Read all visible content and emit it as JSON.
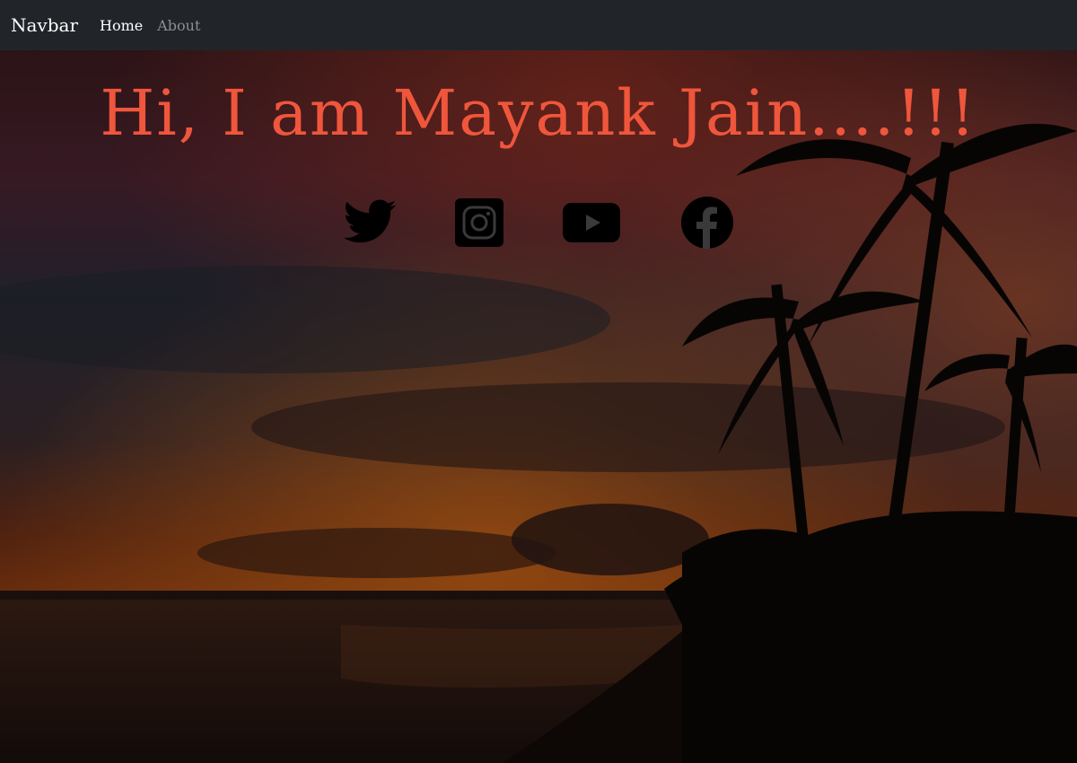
{
  "navbar": {
    "brand": "Navbar",
    "links": [
      {
        "label": "Home",
        "active": true
      },
      {
        "label": "About",
        "active": false
      }
    ]
  },
  "hero": {
    "headline": "Hi, I am Mayank Jain....!!!",
    "headline_color": "#f0563c",
    "background": "sunset beach with palm tree silhouettes",
    "social_icons": [
      {
        "name": "twitter-icon"
      },
      {
        "name": "instagram-icon"
      },
      {
        "name": "youtube-icon"
      },
      {
        "name": "facebook-icon"
      }
    ],
    "icon_color": "#000000"
  },
  "colors": {
    "navbar_bg": "#212529",
    "link_active": "#ffffff",
    "link_inactive": "#8c8f93"
  }
}
